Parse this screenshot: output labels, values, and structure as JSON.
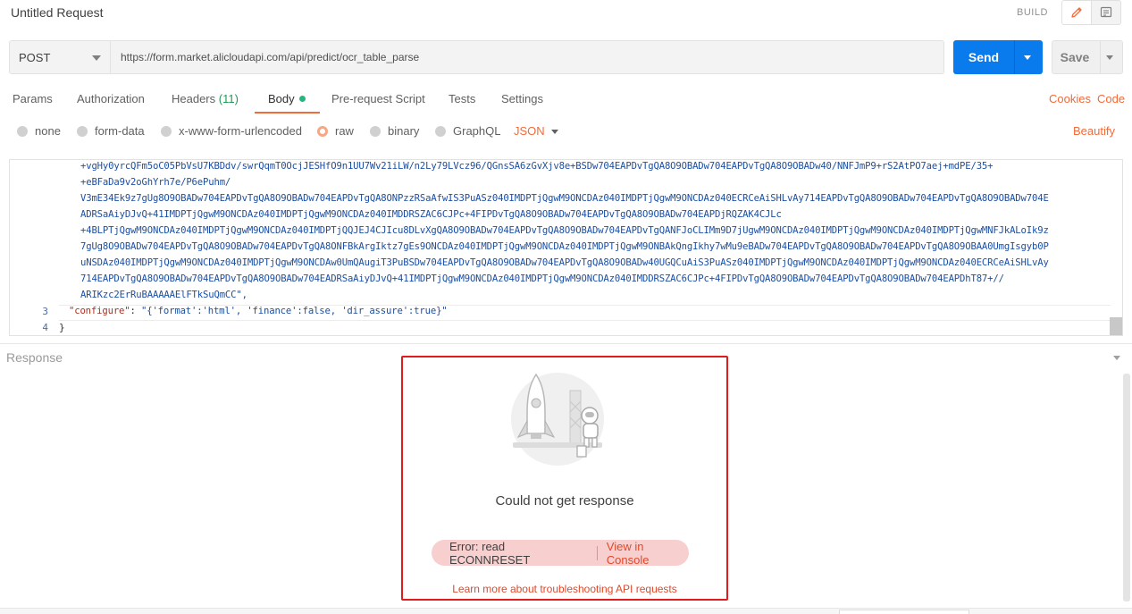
{
  "request": {
    "title": "Untitled Request",
    "build_label": "BUILD",
    "method": "POST",
    "url": "https://form.market.alicloudapi.com/api/predict/ocr_table_parse",
    "send_label": "Send",
    "save_label": "Save"
  },
  "tabs": [
    {
      "label": "Params"
    },
    {
      "label": "Authorization"
    },
    {
      "label": "Headers",
      "count": "(11)"
    },
    {
      "label": "Body",
      "active": true
    },
    {
      "label": "Pre-request Script"
    },
    {
      "label": "Tests"
    },
    {
      "label": "Settings"
    }
  ],
  "right_links": {
    "cookies": "Cookies",
    "code": "Code"
  },
  "body_types": {
    "options": [
      "none",
      "form-data",
      "x-www-form-urlencoded",
      "raw",
      "binary",
      "GraphQL"
    ],
    "selected": "raw",
    "format": "JSON",
    "beautify": "Beautify"
  },
  "editor": {
    "wrapped_lines": [
      "+vgHy0yrcQFm5oC05PbVsU7KBDdv/swrQqmT0OcjJESHfO9n1UU7Wv21iLW/n2Ly79LVcz96/QGnsSA6zGvXjv8e+BSDw704EAPDvTgQA8O9OBADw704EAPDvTgQA8O9OBADw40/NNFJmP9+rS2AtPO7aej+mdPE/35+",
      "+eBFaDa9v2oGhYrh7e/P6ePuhm/",
      "V3mE34Ek9z7gUg8O9OBADw704EAPDvTgQA8O9OBADw704EAPDvTgQA8ONPzzRSaAfwIS3PuASz040IMDPTjQgwM9ONCDAz040IMDPTjQgwM9ONCDAz040ECRCeAiSHLvAy714EAPDvTgQA8O9OBADw704EAPDvTgQA8O9OBADw704E",
      "ADRSaAiyDJvQ+41IMDPTjQgwM9ONCDAz040IMDPTjQgwM9ONCDAz040IMDDRSZAC6CJPc+4FIPDvTgQA8O9OBADw704EAPDvTgQA8O9OBADw704EAPDjRQZAK4CJLc",
      "+4BLPTjQgwM9ONCDAz040IMDPTjQgwM9ONCDAz040IMDPTjQQJEJ4CJIcu8DLvXgQA8O9OBADw704EAPDvTgQA8O9OBADw704EAPDvTgQANFJoCLIMm9D7jUgwM9ONCDAz040IMDPTjQgwM9ONCDAz040IMDPTjQgwMNFJkALoIk9z",
      "7gUg8O9OBADw704EAPDvTgQA8O9OBADw704EAPDvTgQA8ONFBkArgIktz7gEs9ONCDAz040IMDPTjQgwM9ONCDAz040IMDPTjQgwM9ONBAkQngIkhy7wMu9eBADw704EAPDvTgQA8O9OBADw704EAPDvTgQA8O9OBAA0UmgIsgyb0P",
      "uNSDAz040IMDPTjQgwM9ONCDAz040IMDPTjQgwM9ONCDAw0UmQAugiT3PuBSDw704EAPDvTgQA8O9OBADw704EAPDvTgQA8O9OBADw40UGQCuAiS3PuASz040IMDPTjQgwM9ONCDAz040IMDPTjQgwM9ONCDAz040ECRCeAiSHLvAy",
      "714EAPDvTgQA8O9OBADw704EAPDvTgQA8O9OBADw704EADRSaAiyDJvQ+41IMDPTjQgwM9ONCDAz040IMDPTjQgwM9ONCDAz040IMDDRSZAC6CJPc+4FIPDvTgQA8O9OBADw704EAPDvTgQA8O9OBADw704EAPDhT87+//",
      "ARIKzc2ErRuBAAAAAElFTkSuQmCC\","
    ],
    "line3_number": "3",
    "line3_key": "\"configure\"",
    "line3_colon": ": ",
    "line3_value": "\"{'format':'html', 'finance':false, 'dir_assure':true}\"",
    "line4_number": "4",
    "line4_text": "}"
  },
  "response": {
    "title": "Response",
    "message": "Could not get response",
    "error": "Error: read ECONNRESET",
    "view_console": "View in Console",
    "learn_more": "Learn more about troubleshooting API requests"
  },
  "colors": {
    "send_blue": "#097bed",
    "accent_orange": "#f26b3a",
    "error_red": "#e0492b",
    "highlight_red": "#e01b1b",
    "pill_bg": "#f7cfcf"
  },
  "icons": [
    "pencil-icon",
    "document-icon",
    "caret-down-icon",
    "rocket-illustration"
  ]
}
